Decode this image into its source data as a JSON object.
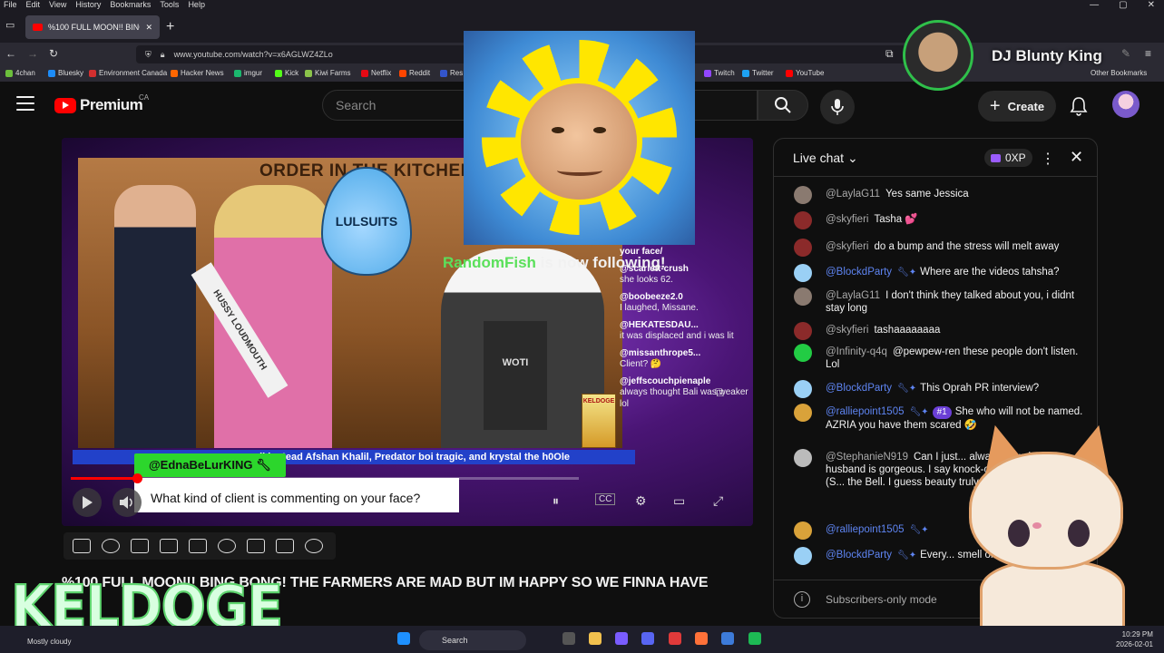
{
  "browser": {
    "menu": [
      "File",
      "Edit",
      "View",
      "History",
      "Bookmarks",
      "Tools",
      "Help"
    ],
    "tab_title": "%100 FULL MOON!! BING B",
    "new_tab": "+",
    "url": "www.youtube.com/watch?v=x6AGLWZ4ZLo",
    "bookmarks": [
      {
        "label": "4chan",
        "color": "#6cbf3c"
      },
      {
        "label": "Bluesky",
        "color": "#1d8cf8"
      },
      {
        "label": "Environment Canada",
        "color": "#d32f2f"
      },
      {
        "label": "Hacker News",
        "color": "#ff6600"
      },
      {
        "label": "imgur",
        "color": "#1bb76e"
      },
      {
        "label": "Kick",
        "color": "#53fc18"
      },
      {
        "label": "Kiwi Farms",
        "color": "#8bc34a"
      },
      {
        "label": "Netflix",
        "color": "#e50914"
      },
      {
        "label": "Reddit",
        "color": "#ff4500"
      },
      {
        "label": "Res",
        "color": "#3355cc"
      },
      {
        "label": "Twitch",
        "color": "#9146ff"
      },
      {
        "label": "Twitter",
        "color": "#1da1f2"
      },
      {
        "label": "YouTube",
        "color": "#ff0000"
      }
    ],
    "other_bookmarks": "Other Bookmarks"
  },
  "youtube": {
    "logo_text": "Premium",
    "region": "CA",
    "search_placeholder": "Search",
    "create_label": "Create"
  },
  "player": {
    "thumb_title": "ORDER IN THE KITCHEN",
    "drop_text": "LULSUITS",
    "sash_text": "HUSSY LOUDMOUTH",
    "apron_text": "WOTI",
    "cereal_text": "KELDOGE",
    "follow_user": "RandomFish",
    "follow_text": " is now following!",
    "ticker": "ail instead Afshan Khalil, Predator boi tragic, and krystal the h0Ole",
    "tag_user": "@EdnaBeLurKING",
    "question": "What kind of client is commenting on your face?",
    "progress": 0.13,
    "overlay_chat": [
      {
        "name": "your face/",
        "msg": ""
      },
      {
        "name": "@scarlett-crush",
        "msg": "she looks 62."
      },
      {
        "name": "@boobeeze2.0",
        "msg": "I laughed, Missane."
      },
      {
        "name": "@HEKATESDAU...",
        "msg": "it was displaced and i was lit"
      },
      {
        "name": "@missanthrope5...",
        "msg": "Client? 🤔"
      },
      {
        "name": "@jeffscouchpienaple",
        "msg": "always thought Bali was weaker lol"
      }
    ]
  },
  "overlay": {
    "dj_name": "DJ Blunty King",
    "keldoge": "KELDOGE"
  },
  "video_title": "%100 FULL MOON!! BING BONG! THE FARMERS ARE MAD BUT IM HAPPY SO WE FINNA HAVE",
  "chat": {
    "title": "Live chat",
    "xp": "0XP",
    "footer": "Subscribers-only mode",
    "messages": [
      {
        "name": "@LaylaG11",
        "text": "Yes same Jessica",
        "mod": false,
        "avatar": "#8a7a70",
        "rank": ""
      },
      {
        "name": "@skyfieri",
        "text": "Tasha 💕",
        "mod": false,
        "avatar": "#8b2a2a",
        "rank": ""
      },
      {
        "name": "@skyfieri",
        "text": "do a bump and the stress will melt away",
        "mod": false,
        "avatar": "#8b2a2a",
        "rank": ""
      },
      {
        "name": "@BlockdParty",
        "text": "Where are the videos tahsha?",
        "mod": true,
        "avatar": "#9ad0f5",
        "rank": ""
      },
      {
        "name": "@LaylaG11",
        "text": "I don't think they talked about you, i didnt stay long",
        "mod": false,
        "avatar": "#8a7a70",
        "rank": ""
      },
      {
        "name": "@skyfieri",
        "text": "tashaaaaaaaa",
        "mod": false,
        "avatar": "#8b2a2a",
        "rank": ""
      },
      {
        "name": "@Infinity-q4q",
        "text": "@pewpew-ren these people don't listen. Lol",
        "mod": false,
        "avatar": "#22cc44",
        "rank": ""
      },
      {
        "name": "@BlockdParty",
        "text": "This Oprah PR interview?",
        "mod": true,
        "avatar": "#9ad0f5",
        "rank": ""
      },
      {
        "name": "@ralliepoint1505",
        "text": "She who will not be named. AZRIA you have them scared 🤣",
        "mod": true,
        "avatar": "#d9a23a",
        "rank": "#1"
      },
      {
        "name": "@StephanieN919",
        "text": "Can I just... always says her husband is gorgeous. I say knock-off Dustin Diamond (S... the Bell. I guess beauty truly... beholder.",
        "mod": false,
        "avatar": "#bbbbbb",
        "rank": ""
      },
      {
        "name": "@ralliepoint1505",
        "text": "",
        "mod": true,
        "avatar": "#d9a23a",
        "rank": ""
      },
      {
        "name": "@BlockdParty",
        "text": "Every... smell onions",
        "mod": true,
        "avatar": "#9ad0f5",
        "rank": ""
      }
    ]
  },
  "taskbar": {
    "weather": "Mostly cloudy",
    "search": "Search",
    "time": "10:29 PM",
    "date": "2026-02-01"
  },
  "colors": {
    "accent_red": "#ff0000",
    "mod_blue": "#5e84f1",
    "follow_green": "#5be05b"
  }
}
